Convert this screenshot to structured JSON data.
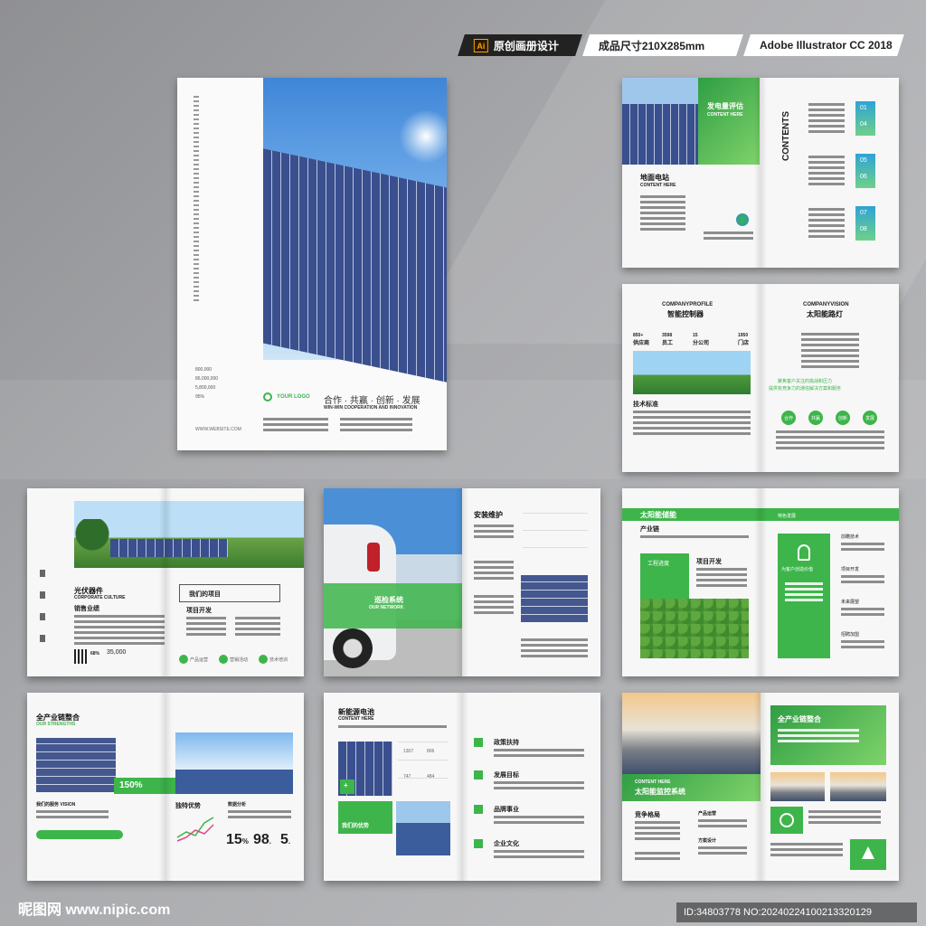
{
  "badges": {
    "icon": "Ai",
    "design": "原创画册设计",
    "size": "成品尺寸210X285mm",
    "software": "Adobe Illustrator CC 2018"
  },
  "cover": {
    "stats": [
      {
        "value": "800,000"
      },
      {
        "value": "86,000,000"
      },
      {
        "value": "5,800,000"
      },
      {
        "value": "95%"
      }
    ],
    "website": "WWW.WEBSITE.COM",
    "logo": "YOUR LOGO",
    "slogan_cn": "合作 · 共赢 · 创新 · 发展",
    "slogan_en": "WIN-WIN COOPERATION AND INNOVATION"
  },
  "p1": {
    "power_title": "发电量评估",
    "power_sub": "CONTENT HERE",
    "ground_title": "地面电站",
    "ground_sub": "CONTENT HERE",
    "toc_head": "TABLE OF",
    "toc_title": "CONTENTS",
    "toc": [
      "01",
      "04",
      "05",
      "06",
      "07",
      "08"
    ]
  },
  "p2": {
    "profile_en": "COMPANYPROFILE",
    "profile_cn": "智能控制器",
    "stats": [
      {
        "num": "850+",
        "label": "供应商"
      },
      {
        "num": "3598",
        "label": "员工"
      },
      {
        "num": "15",
        "label": "分公司"
      },
      {
        "num": "1950",
        "label": "门店"
      }
    ],
    "tech": "技术标准",
    "vision_en": "COMPANYVISION",
    "vision_cn": "太阳能路灯",
    "quote1": "聚焦客户关注的挑战和压力",
    "quote2": "提供有竞争力的通信解决方案和服务",
    "circles": [
      "合作",
      "共赢",
      "创新",
      "发展"
    ]
  },
  "p3": {
    "title": "光伏器件",
    "sub": "CORPORATE CULTURE",
    "sales": "销售业绩",
    "box": "我们的项目",
    "dev": "项目开发",
    "pct": "68%",
    "num": "35,000",
    "icons": [
      "产品运营",
      "营销活动",
      "技术培训"
    ]
  },
  "p4": {
    "install": "安装维护",
    "overlay_cn": "巡检系统",
    "overlay_en": "OUR NETWORK"
  },
  "p5": {
    "title": "太阳能储能",
    "feature": "特色发展",
    "chain": "产业链",
    "engineering": "工程进度",
    "project": "项目开发",
    "service": "为客户创造价值",
    "items": [
      "前瞻技术",
      "项目开发",
      "未来展望",
      "招聘加盟"
    ]
  },
  "p6": {
    "title": "全产业链整合",
    "sub": "OUR STRENGTHS",
    "badge": "150%",
    "vision": "我们的服务 VISION",
    "trend": "独特优势",
    "labels": [
      "数据分析"
    ],
    "stats": [
      {
        "num": "15",
        "unit": "%"
      },
      {
        "num": "98",
        "unit": "."
      },
      {
        "num": "5",
        "unit": "."
      }
    ]
  },
  "p7": {
    "title": "新能源电池",
    "sub": "CONTENT HERE",
    "adv": "我们的优势",
    "items": [
      "政策扶持",
      "发展目标",
      "品牌事业",
      "企业文化"
    ],
    "nums": [
      "1307",
      "806",
      "747",
      "484"
    ]
  },
  "p8": {
    "chain": "全产业链整合",
    "here": "CONTENT HERE",
    "monitor_en": "CONTENT HERE",
    "monitor_cn": "太阳能监控系统",
    "compete": "竞争格局",
    "cols": [
      "产品运营",
      "方案设计"
    ]
  },
  "footer": {
    "site": "昵图网 www.nipic.com",
    "id": "ID:34803778 NO:20240224100213320129"
  }
}
